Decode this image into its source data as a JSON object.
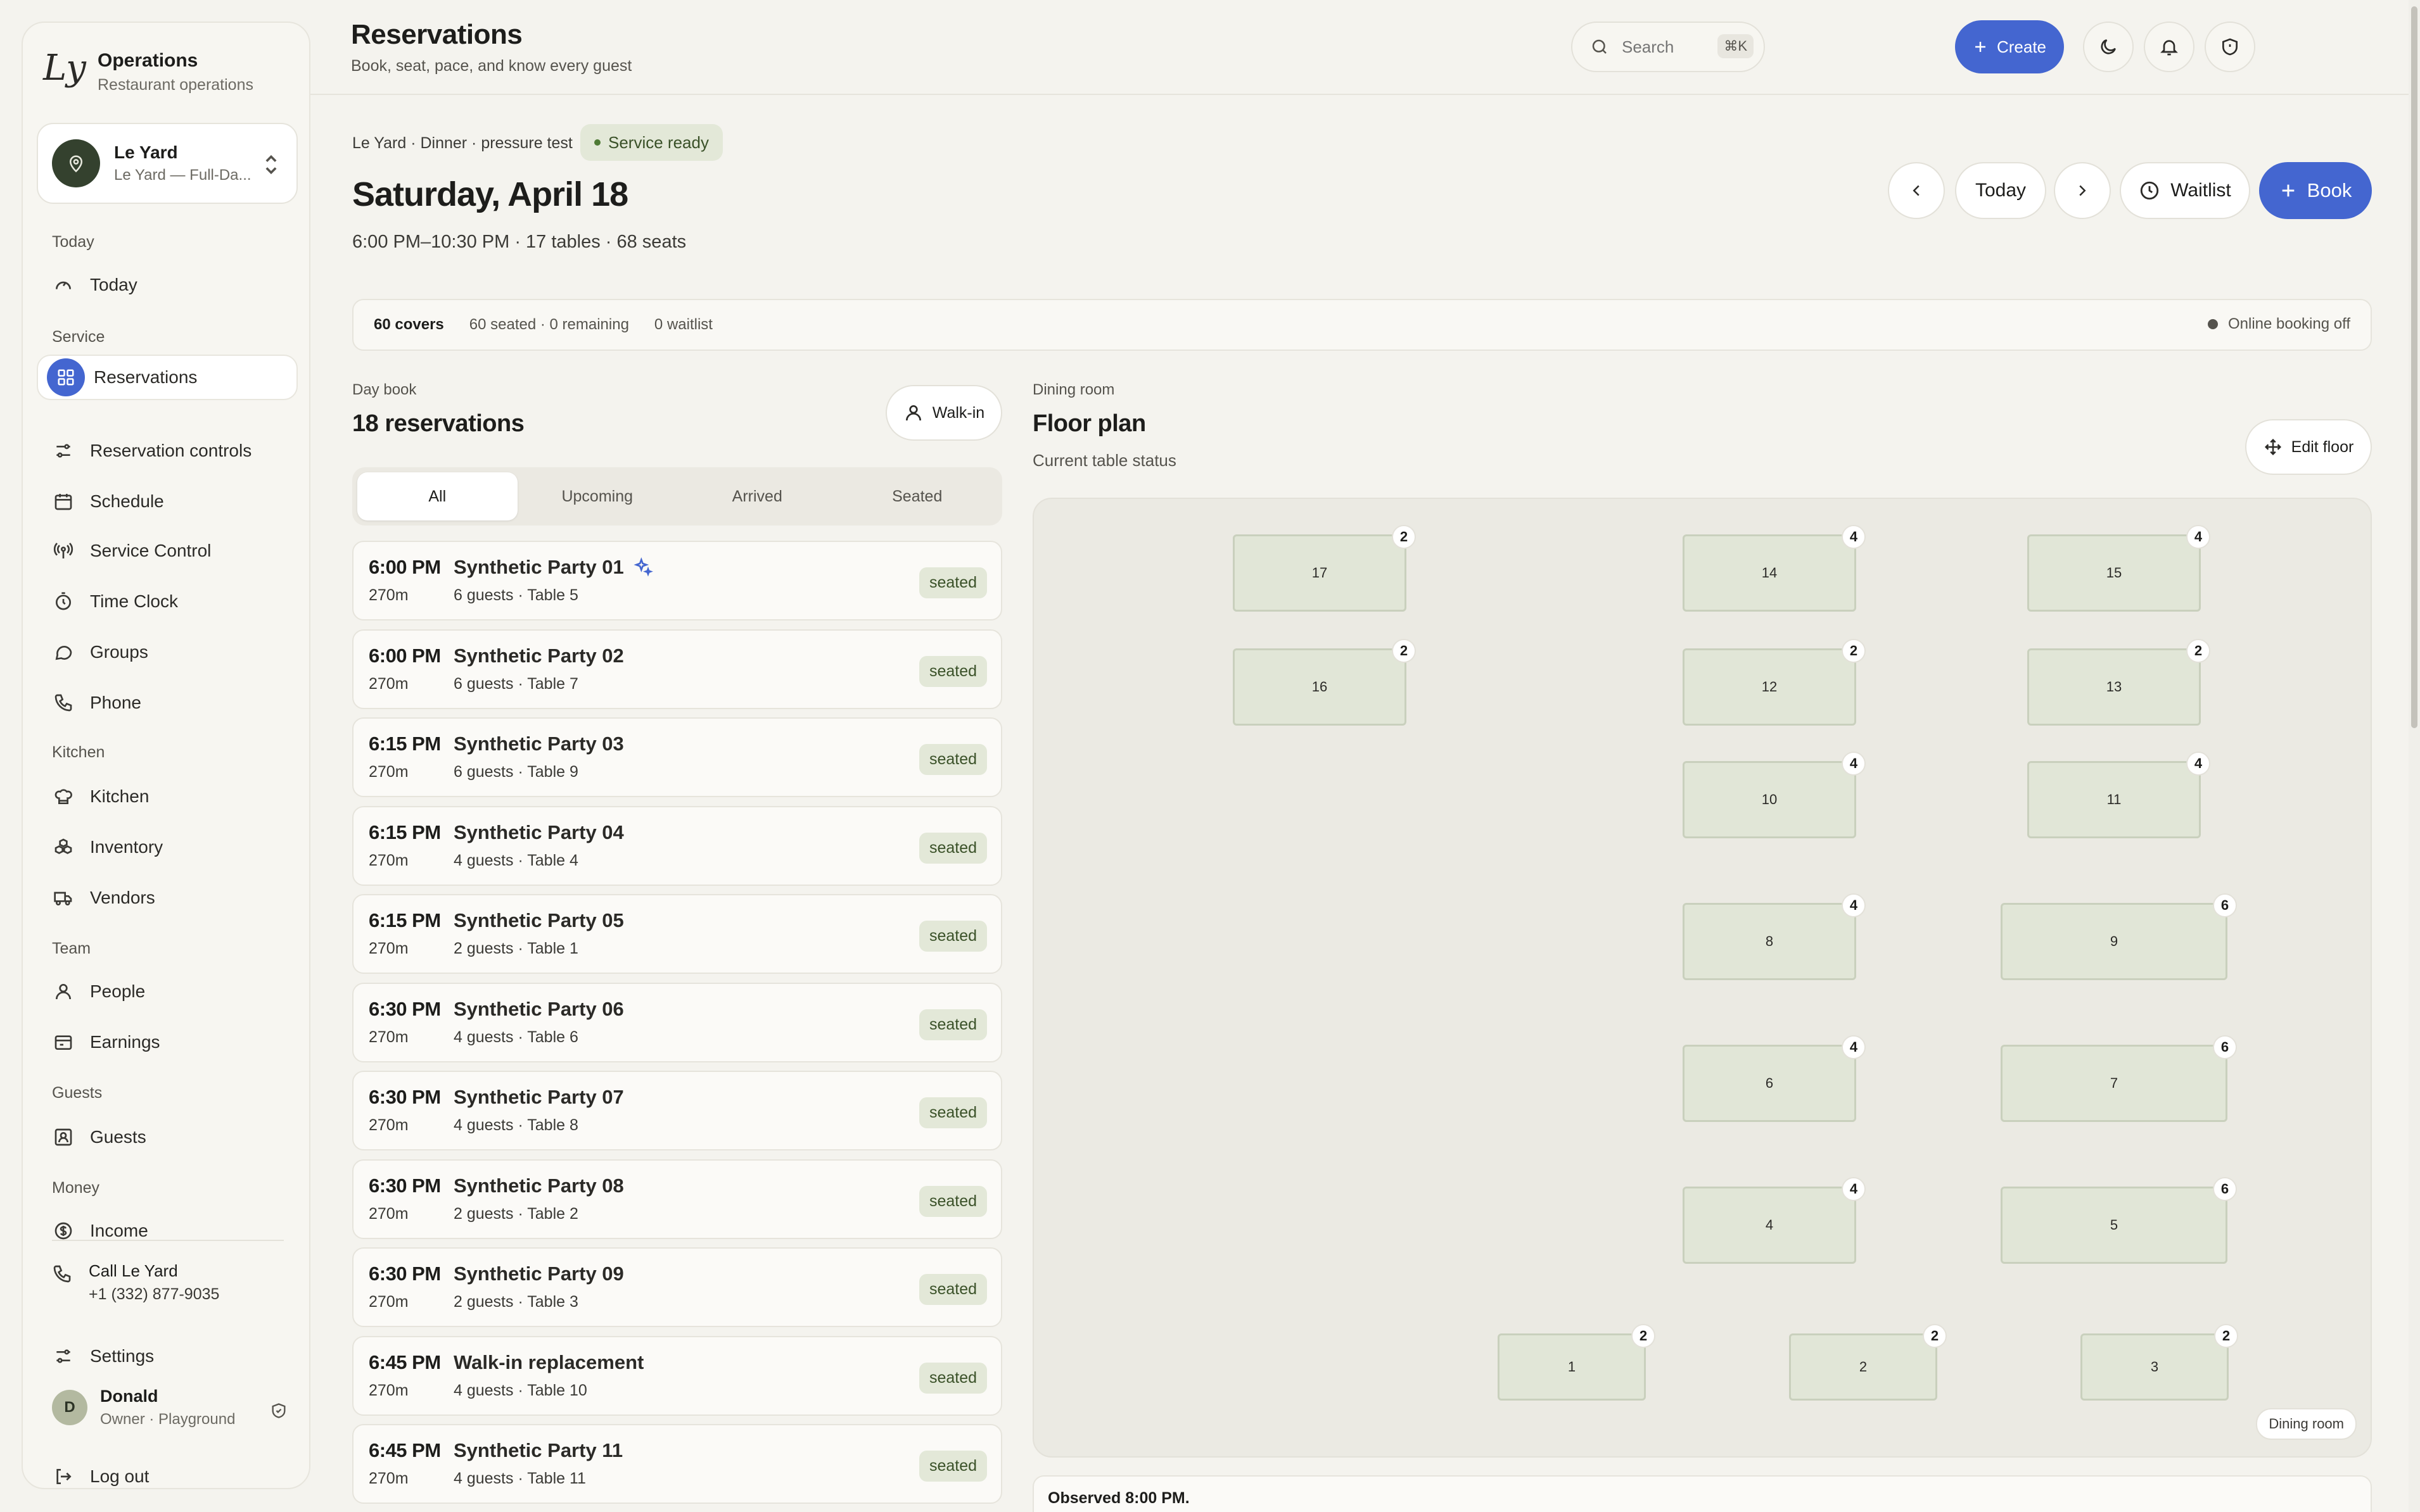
{
  "brand": {
    "title": "Operations",
    "subtitle": "Restaurant operations",
    "logo_text": "Ly"
  },
  "location": {
    "name": "Le Yard",
    "sub": "Le Yard — Full-Da..."
  },
  "nav": {
    "today_section": "Today",
    "today": "Today",
    "service_section": "Service",
    "reservations": "Reservations",
    "reservation_controls": "Reservation controls",
    "schedule": "Schedule",
    "service_control": "Service Control",
    "time_clock": "Time Clock",
    "groups": "Groups",
    "phone": "Phone",
    "kitchen_section": "Kitchen",
    "kitchen": "Kitchen",
    "inventory": "Inventory",
    "vendors": "Vendors",
    "team_section": "Team",
    "people": "People",
    "earnings": "Earnings",
    "guests_section": "Guests",
    "guests": "Guests",
    "money_section": "Money",
    "income": "Income"
  },
  "call": {
    "title": "Call Le Yard",
    "number": "+1 (332) 877-9035"
  },
  "settings_label": "Settings",
  "user": {
    "initial": "D",
    "name": "Donald",
    "role": "Owner · Playground"
  },
  "logout_label": "Log out",
  "header": {
    "title": "Reservations",
    "subtitle": "Book, seat, pace, and know every guest",
    "search_placeholder": "Search",
    "search_shortcut": "⌘K",
    "create_label": "Create"
  },
  "service": {
    "breadcrumb": "Le Yard · Dinner · pressure test",
    "status": "Service ready",
    "date": "Saturday, April 18",
    "meta": "6:00 PM–10:30 PM · 17 tables · 68 seats",
    "today_label": "Today",
    "waitlist_label": "Waitlist",
    "book_label": "Book"
  },
  "covers": {
    "total": "60 covers",
    "seated": "60 seated · 0 remaining",
    "waitlist": "0 waitlist",
    "online": "Online booking off"
  },
  "daybook": {
    "label": "Day book",
    "count": "18 reservations",
    "walkin_label": "Walk-in",
    "tabs": [
      "All",
      "Upcoming",
      "Arrived",
      "Seated"
    ],
    "reservations": [
      {
        "time": "6:00 PM",
        "duration": "270m",
        "name": "Synthetic Party 01",
        "detail": "6 guests · Table 5",
        "status": "seated",
        "sparkle": true
      },
      {
        "time": "6:00 PM",
        "duration": "270m",
        "name": "Synthetic Party 02",
        "detail": "6 guests · Table 7",
        "status": "seated"
      },
      {
        "time": "6:15 PM",
        "duration": "270m",
        "name": "Synthetic Party 03",
        "detail": "6 guests · Table 9",
        "status": "seated"
      },
      {
        "time": "6:15 PM",
        "duration": "270m",
        "name": "Synthetic Party 04",
        "detail": "4 guests · Table 4",
        "status": "seated"
      },
      {
        "time": "6:15 PM",
        "duration": "270m",
        "name": "Synthetic Party 05",
        "detail": "2 guests · Table 1",
        "status": "seated"
      },
      {
        "time": "6:30 PM",
        "duration": "270m",
        "name": "Synthetic Party 06",
        "detail": "4 guests · Table 6",
        "status": "seated"
      },
      {
        "time": "6:30 PM",
        "duration": "270m",
        "name": "Synthetic Party 07",
        "detail": "4 guests · Table 8",
        "status": "seated"
      },
      {
        "time": "6:30 PM",
        "duration": "270m",
        "name": "Synthetic Party 08",
        "detail": "2 guests · Table 2",
        "status": "seated"
      },
      {
        "time": "6:30 PM",
        "duration": "270m",
        "name": "Synthetic Party 09",
        "detail": "2 guests · Table 3",
        "status": "seated"
      },
      {
        "time": "6:45 PM",
        "duration": "270m",
        "name": "Walk-in replacement",
        "detail": "4 guests · Table 10",
        "status": "seated"
      },
      {
        "time": "6:45 PM",
        "duration": "270m",
        "name": "Synthetic Party 11",
        "detail": "4 guests · Table 11",
        "status": "seated"
      }
    ]
  },
  "floor": {
    "label": "Dining room",
    "title": "Floor plan",
    "subtitle": "Current table status",
    "edit_label": "Edit floor",
    "room_chip": "Dining room",
    "tables": [
      {
        "number": "17",
        "seats": "2"
      },
      {
        "number": "14",
        "seats": "4"
      },
      {
        "number": "15",
        "seats": "4"
      },
      {
        "number": "16",
        "seats": "2"
      },
      {
        "number": "12",
        "seats": "2"
      },
      {
        "number": "13",
        "seats": "2"
      },
      {
        "number": "10",
        "seats": "4"
      },
      {
        "number": "11",
        "seats": "4"
      },
      {
        "number": "8",
        "seats": "4"
      },
      {
        "number": "9",
        "seats": "6"
      },
      {
        "number": "6",
        "seats": "4"
      },
      {
        "number": "7",
        "seats": "6"
      },
      {
        "number": "4",
        "seats": "4"
      },
      {
        "number": "5",
        "seats": "6"
      },
      {
        "number": "1",
        "seats": "2"
      },
      {
        "number": "2",
        "seats": "2"
      },
      {
        "number": "3",
        "seats": "2"
      }
    ]
  },
  "observed": "Observed 8:00 PM.",
  "colors": {
    "accent": "#4466d0",
    "seated_bg": "#e3e8d8",
    "seated_text": "#3a5128",
    "table_fill": "#e1e6d7"
  }
}
